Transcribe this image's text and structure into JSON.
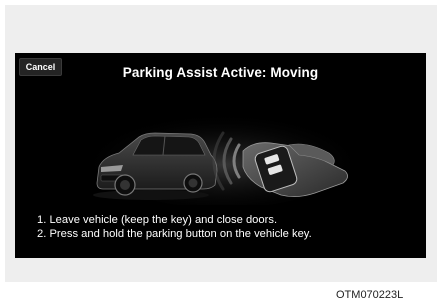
{
  "screen": {
    "cancel_label": "Cancel",
    "title": "Parking Assist Active: Moving",
    "steps": [
      "1. Leave vehicle (keep the key) and close doors.",
      "2. Press and hold the parking button on the vehicle key."
    ]
  },
  "illustration": {
    "car_icon": "suv-icon",
    "key_icon": "hand-holding-key-fob-icon",
    "signal_icon": "wireless-signal-icon"
  },
  "caption": "OTM070223L",
  "colors": {
    "screen_background": "#000000",
    "panel_background": "#eeeeee",
    "text": "#ffffff"
  }
}
